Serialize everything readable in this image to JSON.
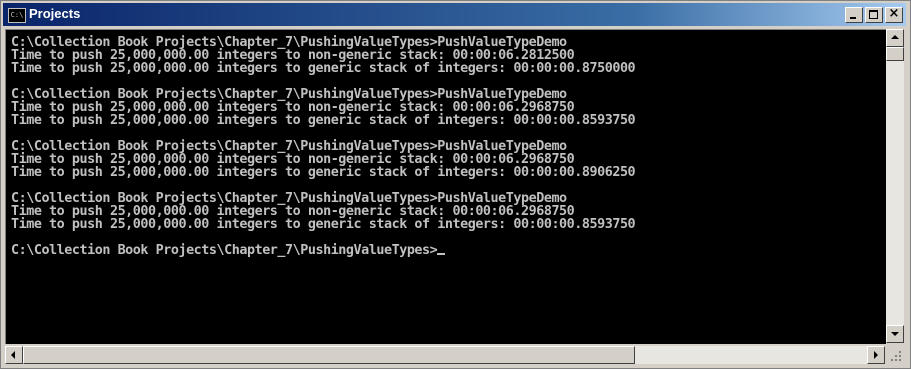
{
  "window": {
    "title": "Projects",
    "icon": "console-icon",
    "icon_text": "C:\\"
  },
  "console": {
    "lines": [
      "C:\\Collection Book Projects\\Chapter_7\\PushingValueTypes>PushValueTypeDemo",
      "Time to push 25,000,000.00 integers to non-generic stack: 00:00:06.2812500",
      "Time to push 25,000,000.00 integers to generic stack of integers: 00:00:00.8750000",
      "",
      "C:\\Collection Book Projects\\Chapter_7\\PushingValueTypes>PushValueTypeDemo",
      "Time to push 25,000,000.00 integers to non-generic stack: 00:00:06.2968750",
      "Time to push 25,000,000.00 integers to generic stack of integers: 00:00:00.8593750",
      "",
      "C:\\Collection Book Projects\\Chapter_7\\PushingValueTypes>PushValueTypeDemo",
      "Time to push 25,000,000.00 integers to non-generic stack: 00:00:06.2968750",
      "Time to push 25,000,000.00 integers to generic stack of integers: 00:00:00.8906250",
      "",
      "C:\\Collection Book Projects\\Chapter_7\\PushingValueTypes>PushValueTypeDemo",
      "Time to push 25,000,000.00 integers to non-generic stack: 00:00:06.2968750",
      "Time to push 25,000,000.00 integers to generic stack of integers: 00:00:00.8593750",
      "",
      "C:\\Collection Book Projects\\Chapter_7\\PushingValueTypes>"
    ]
  },
  "colors": {
    "console_bg": "#000000",
    "console_fg": "#c0c0c0",
    "titlebar_start": "#0a246a",
    "titlebar_end": "#a6caf0"
  }
}
